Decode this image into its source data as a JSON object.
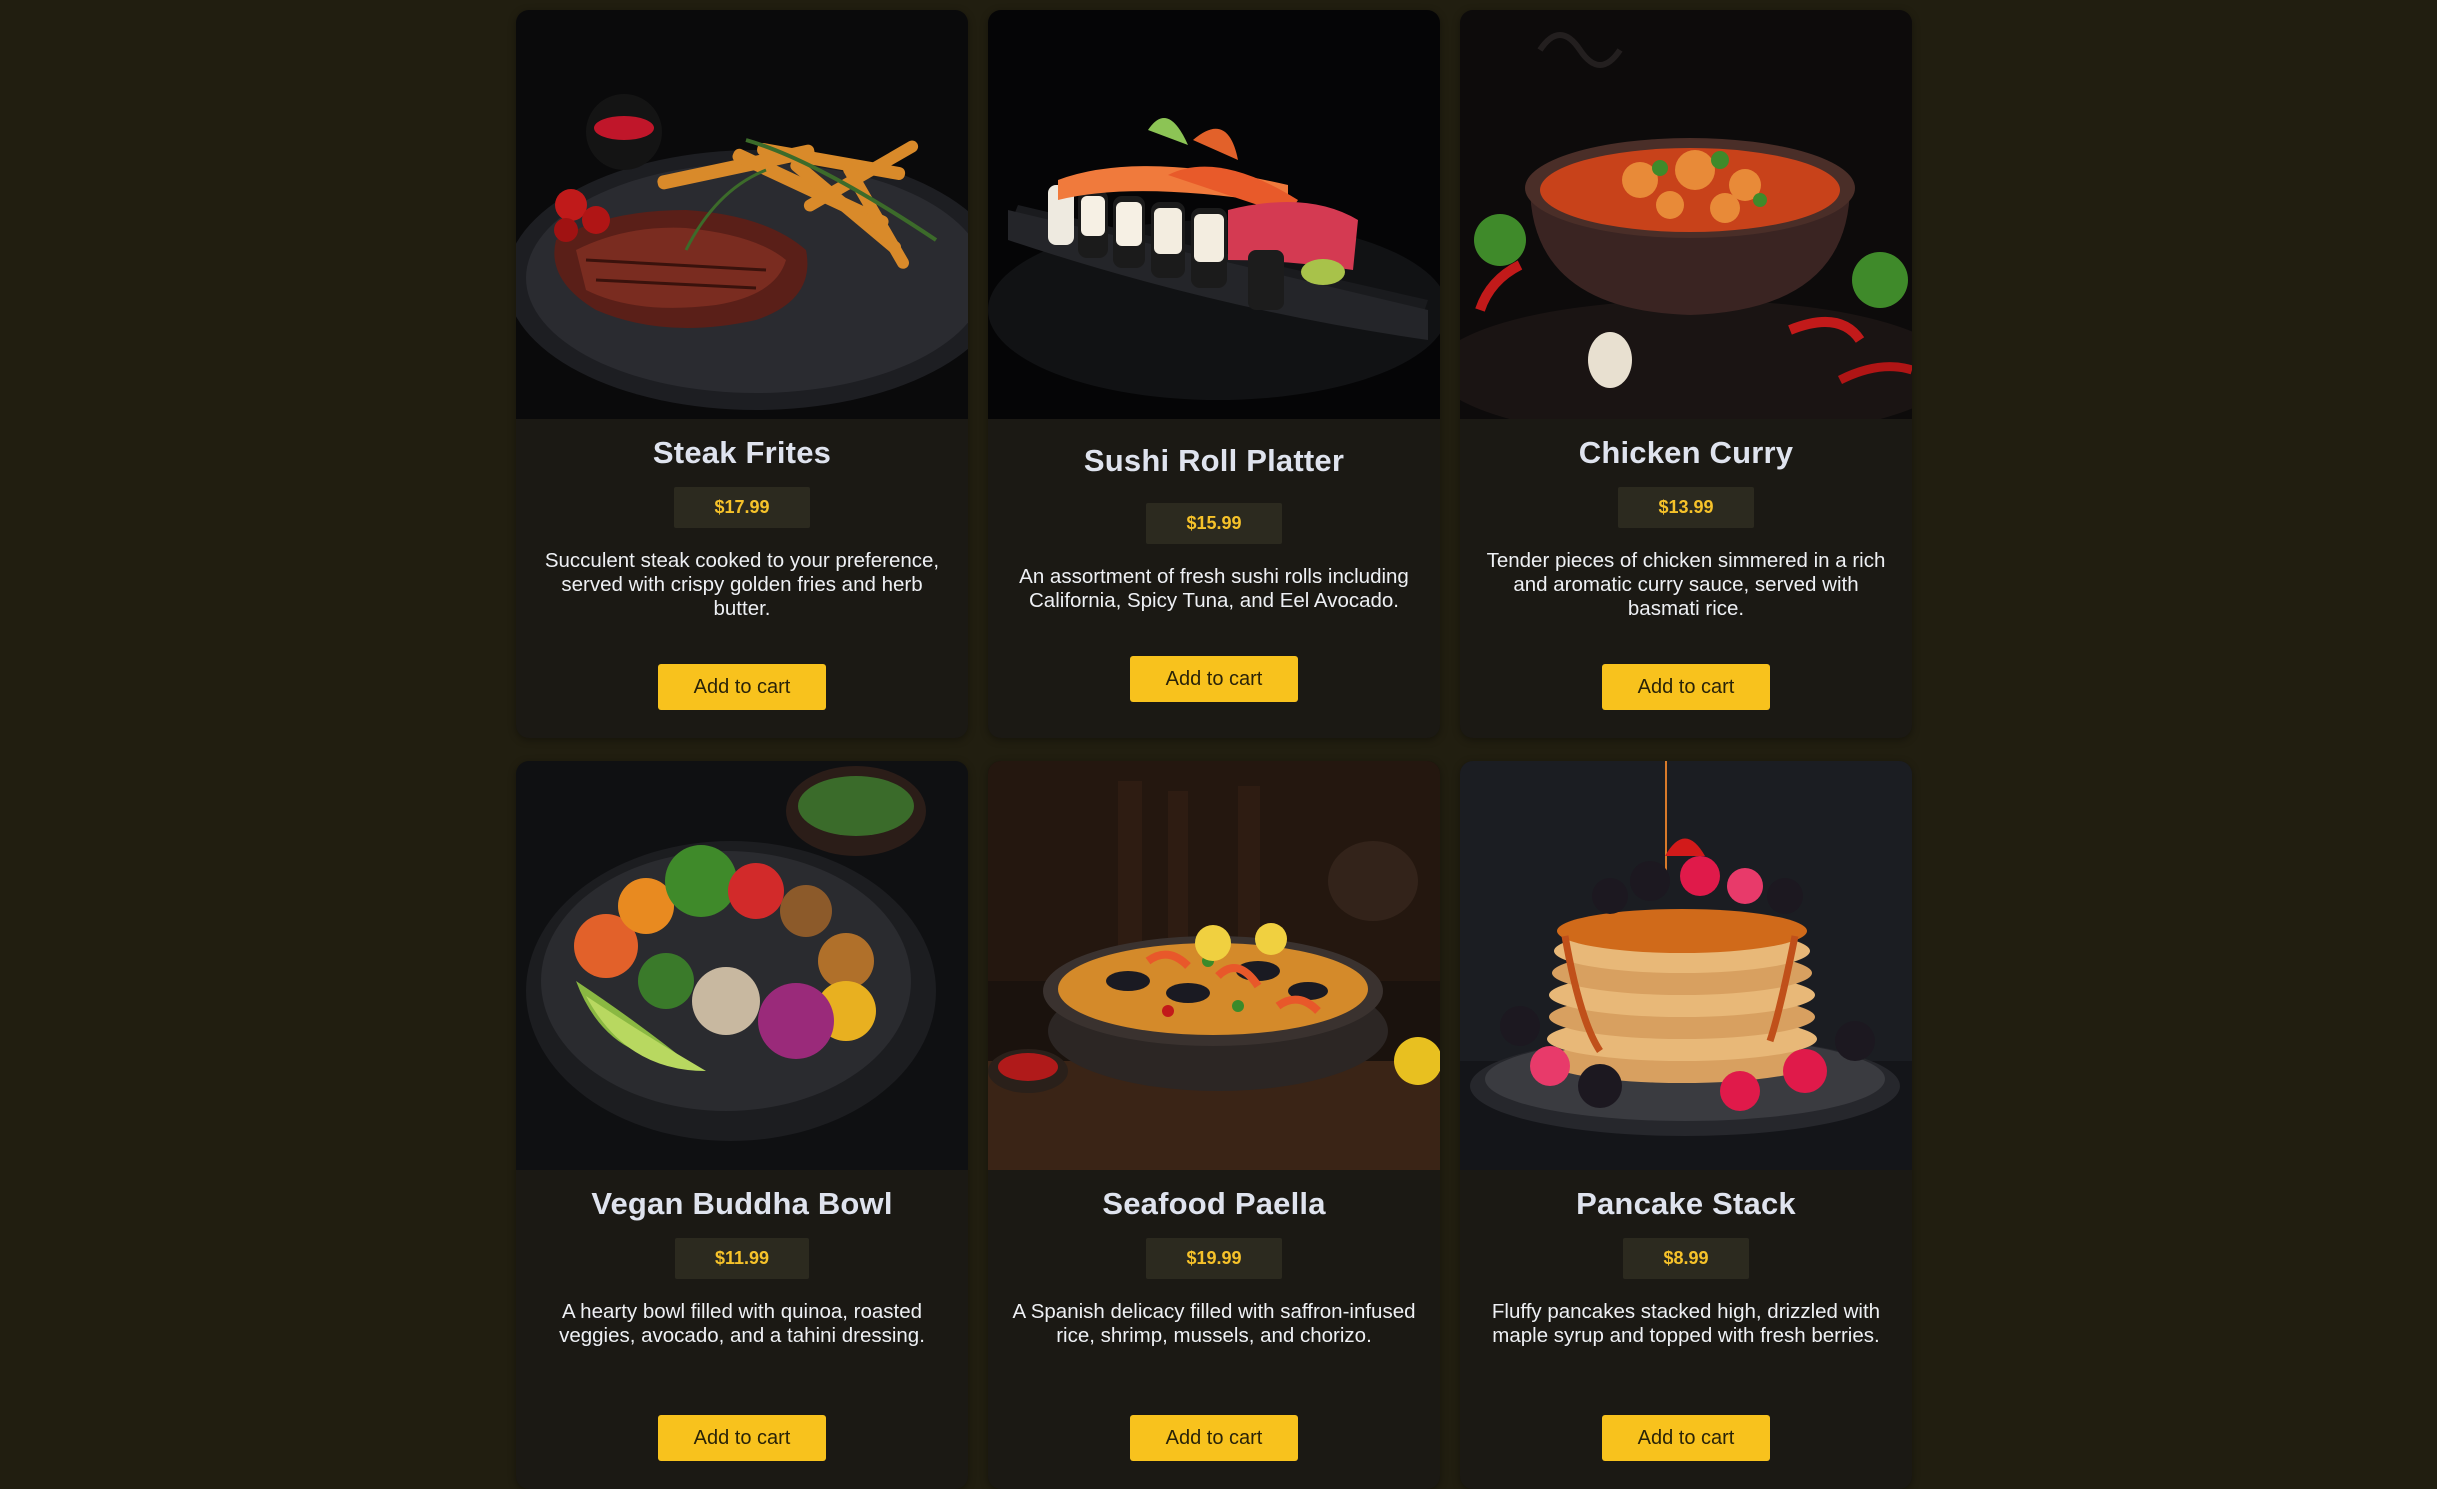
{
  "colors": {
    "page_background": "#211e10",
    "card_background": "#1b1914",
    "price_text": "#f6c22a",
    "button_background": "#f8c21d"
  },
  "menu": {
    "items": [
      {
        "name": "Steak Frites",
        "price": "$17.99",
        "description": "Succulent steak cooked to your preference, served with crispy golden fries and herb butter.",
        "button": "Add to cart",
        "image": "steak-frites-photo"
      },
      {
        "name": "Sushi Roll Platter",
        "price": "$15.99",
        "description": "An assortment of fresh sushi rolls including California, Spicy Tuna, and Eel Avocado.",
        "button": "Add to cart",
        "image": "sushi-platter-photo"
      },
      {
        "name": "Chicken Curry",
        "price": "$13.99",
        "description": "Tender pieces of chicken simmered in a rich and aromatic curry sauce, served with basmati rice.",
        "button": "Add to cart",
        "image": "chicken-curry-photo"
      },
      {
        "name": "Vegan Buddha Bowl",
        "price": "$11.99",
        "description": "A hearty bowl filled with quinoa, roasted veggies, avocado, and a tahini dressing.",
        "button": "Add to cart",
        "image": "buddha-bowl-photo"
      },
      {
        "name": "Seafood Paella",
        "price": "$19.99",
        "description": "A Spanish delicacy filled with saffron-infused rice, shrimp, mussels, and chorizo.",
        "button": "Add to cart",
        "image": "paella-photo"
      },
      {
        "name": "Pancake Stack",
        "price": "$8.99",
        "description": "Fluffy pancakes stacked high, drizzled with maple syrup and topped with fresh berries.",
        "button": "Add to cart",
        "image": "pancake-stack-photo"
      }
    ]
  }
}
